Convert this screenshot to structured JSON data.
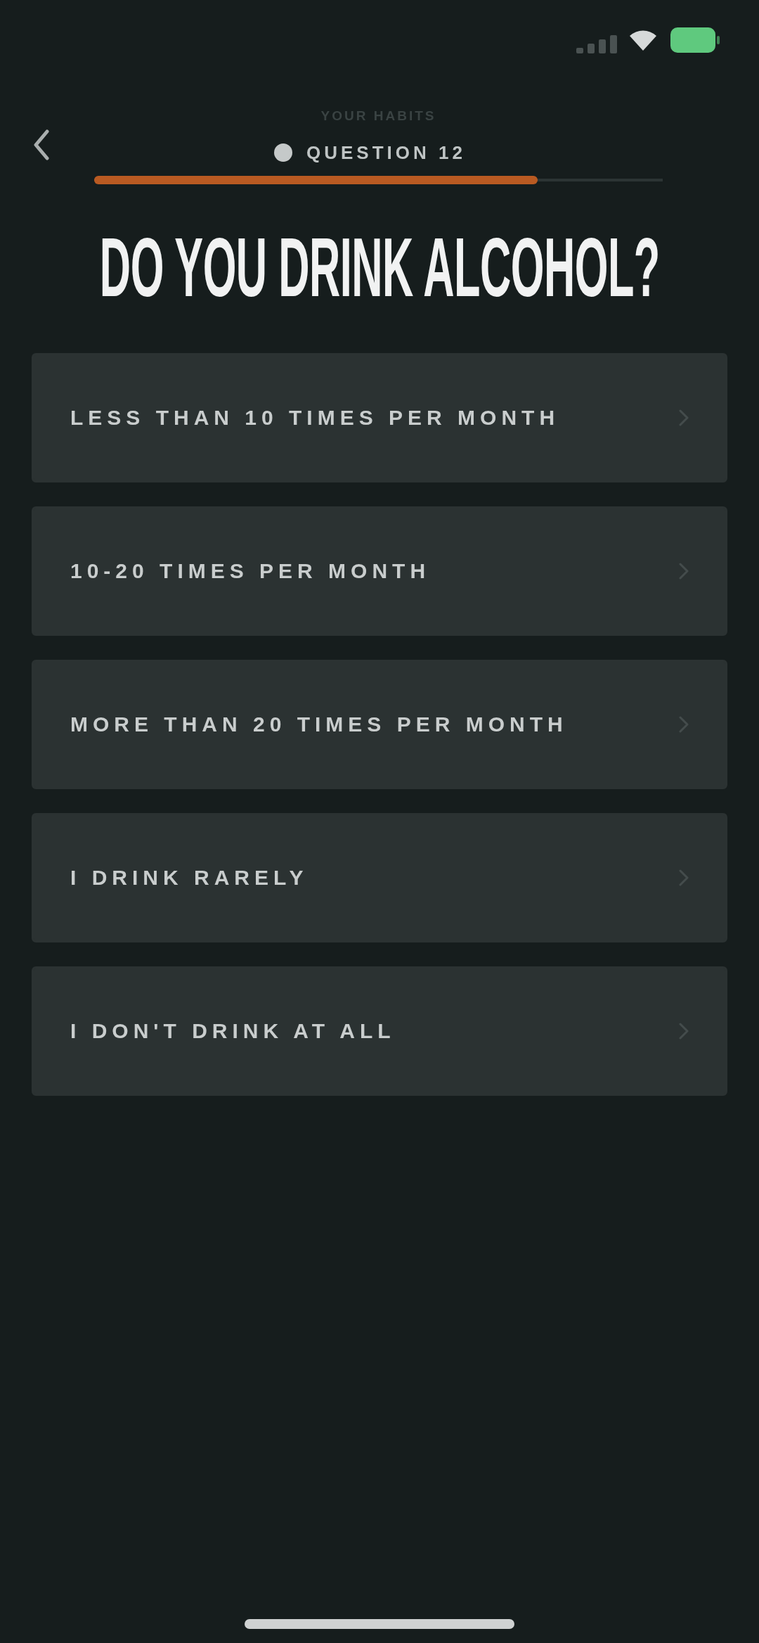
{
  "header": {
    "step_label": "YOUR HABITS",
    "question_label": "QUESTION 12",
    "progress": {
      "level": 0.78
    }
  },
  "title": "DO YOU DRINK ALCOHOL?",
  "options": [
    {
      "label": "LESS THAN 10 TIMES PER MONTH",
      "selected": false
    },
    {
      "label": "10-20 TIMES PER MONTH",
      "selected": false
    },
    {
      "label": "MORE THAN 20 TIMES PER MONTH",
      "selected": false
    },
    {
      "label": "I DRINK RARELY",
      "selected": false
    },
    {
      "label": "I DON'T DRINK AT ALL",
      "selected": false
    }
  ]
}
